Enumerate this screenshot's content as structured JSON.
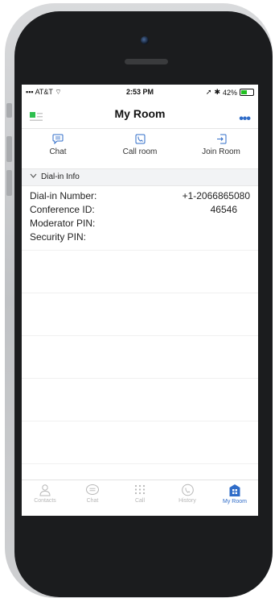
{
  "status_bar": {
    "carrier": "AT&T",
    "time": "2:53 PM",
    "battery": "42%"
  },
  "nav": {
    "title": "My Room"
  },
  "actions": [
    {
      "label": "Chat"
    },
    {
      "label": "Call room"
    },
    {
      "label": "Join Room"
    }
  ],
  "section": {
    "label": "Dial-in Info"
  },
  "info": [
    {
      "label": "Dial-in Number:",
      "value": "+1-2066865080"
    },
    {
      "label": "Conference ID:",
      "value": "46546"
    },
    {
      "label": "Moderator PIN:",
      "value": ""
    },
    {
      "label": "Security PIN:",
      "value": ""
    }
  ],
  "tabs": [
    {
      "label": "Contacts",
      "icon": "contacts-icon"
    },
    {
      "label": "Chat",
      "icon": "chat-icon"
    },
    {
      "label": "Call",
      "icon": "dialpad-icon"
    },
    {
      "label": "History",
      "icon": "history-icon"
    },
    {
      "label": "My Room",
      "icon": "my-room-icon",
      "active": true
    }
  ],
  "colors": {
    "accent": "#2f6cc8",
    "brand_green": "#2fbf4f",
    "inactive": "#b7b7b7"
  }
}
